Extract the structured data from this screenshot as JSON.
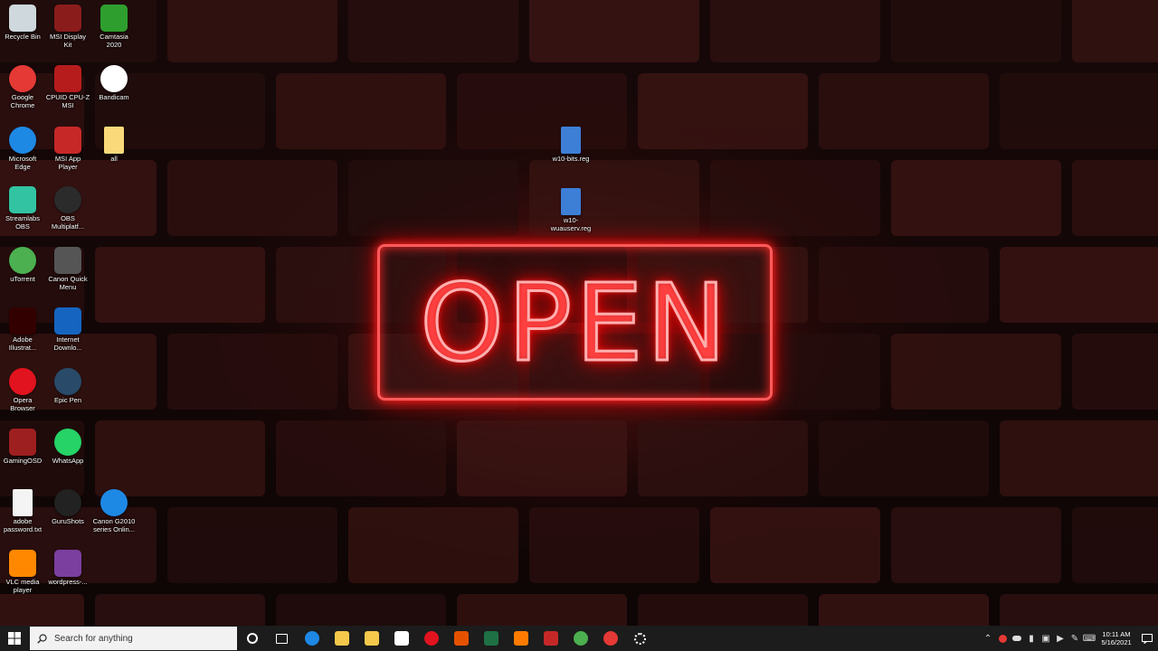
{
  "desktop": {
    "icons": [
      {
        "label": "Recycle Bin",
        "icon": "recycle-bin-icon",
        "color": "#cfd8dc"
      },
      {
        "label": "MSI Display Kit",
        "icon": "msi-display-kit-icon",
        "color": "#8a1c1c"
      },
      {
        "label": "Camtasia 2020",
        "icon": "camtasia-icon",
        "color": "#2e9e2e"
      },
      {
        "label": "Google Chrome",
        "icon": "chrome-icon",
        "color": "#e53935"
      },
      {
        "label": "CPUID CPU-Z MSI",
        "icon": "cpuz-icon",
        "color": "#b71c1c"
      },
      {
        "label": "Bandicam",
        "icon": "bandicam-icon",
        "color": "#ffffff"
      },
      {
        "label": "Microsoft Edge",
        "icon": "edge-icon",
        "color": "#1e88e5"
      },
      {
        "label": "MSI App Player",
        "icon": "msi-app-player-icon",
        "color": "#c62828"
      },
      {
        "label": "all",
        "icon": "folder-icon",
        "color": "#f9d97a"
      },
      {
        "label": "Streamlabs OBS",
        "icon": "streamlabs-icon",
        "color": "#31c3a2"
      },
      {
        "label": "OBS Multiplatf...",
        "icon": "obs-icon",
        "color": "#2b2b2b"
      },
      {
        "label": "uTorrent",
        "icon": "utorrent-icon",
        "color": "#4caf50"
      },
      {
        "label": "Canon Quick Menu",
        "icon": "canon-quick-menu-icon",
        "color": "#555555"
      },
      {
        "label": "Adobe Illustrat...",
        "icon": "illustrator-icon",
        "color": "#330000"
      },
      {
        "label": "Internet Downlo...",
        "icon": "internet-download-manager-icon",
        "color": "#1565c0"
      },
      {
        "label": "Opera Browser",
        "icon": "opera-icon",
        "color": "#e0131e"
      },
      {
        "label": "Epic Pen",
        "icon": "epic-pen-icon",
        "color": "#2a4a6a"
      },
      {
        "label": "GamingOSD",
        "icon": "gaming-osd-icon",
        "color": "#9e1f1f"
      },
      {
        "label": "WhatsApp",
        "icon": "whatsapp-icon",
        "color": "#25d366"
      },
      {
        "label": "adobe password.txt",
        "icon": "text-file-icon",
        "color": "#f4f4f4"
      },
      {
        "label": "GuruShots",
        "icon": "gurushots-icon",
        "color": "#222222"
      },
      {
        "label": "Canon G2010 series Onlin...",
        "icon": "edge-icon",
        "color": "#1e88e5"
      },
      {
        "label": "VLC media player",
        "icon": "vlc-icon",
        "color": "#ff8800"
      },
      {
        "label": "wordpress-...",
        "icon": "winrar-archive-icon",
        "color": "#7b3fa0"
      },
      {
        "label": "w10-bits.reg",
        "icon": "registry-file-icon",
        "color": "#3d7fd6"
      },
      {
        "label": "w10-wuauserv.reg",
        "icon": "registry-file-icon",
        "color": "#3d7fd6"
      }
    ]
  },
  "wallpaper": {
    "sign_text": "OPEN",
    "neon_color": "#ff2a2a"
  },
  "taskbar": {
    "search_placeholder": "Search for anything",
    "pinned": [
      {
        "name": "cortana",
        "icon": "cortana-circle-icon",
        "color": "#ffffff"
      },
      {
        "name": "task-view",
        "icon": "task-view-icon",
        "color": "#ffffff"
      },
      {
        "name": "edge",
        "icon": "edge-icon",
        "color": "#1e88e5"
      },
      {
        "name": "file-explorer",
        "icon": "file-explorer-icon",
        "color": "#f5c84c"
      },
      {
        "name": "store",
        "icon": "store-icon",
        "color": "#f5c84c"
      },
      {
        "name": "mail",
        "icon": "mail-icon",
        "color": "#ffffff"
      },
      {
        "name": "opera",
        "icon": "opera-icon",
        "color": "#e0131e"
      },
      {
        "name": "office",
        "icon": "office-icon",
        "color": "#e65100"
      },
      {
        "name": "excel",
        "icon": "excel-icon",
        "color": "#1e7145"
      },
      {
        "name": "app-orange",
        "icon": "app-icon",
        "color": "#ff7b00"
      },
      {
        "name": "msi-app",
        "icon": "msi-app-player-icon",
        "color": "#c62828"
      },
      {
        "name": "utorrent",
        "icon": "utorrent-icon",
        "color": "#4caf50"
      },
      {
        "name": "record",
        "icon": "record-icon",
        "color": "#e53935"
      },
      {
        "name": "settings",
        "icon": "gear-icon",
        "color": "#ffffff"
      }
    ],
    "clock": {
      "time": "10:11 AM",
      "date": "5/16/2021"
    }
  }
}
